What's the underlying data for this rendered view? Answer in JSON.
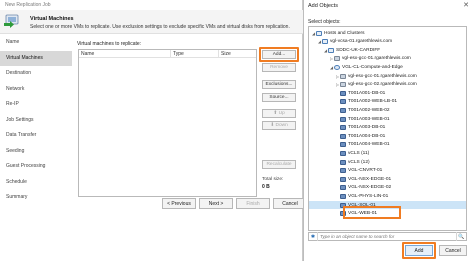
{
  "job_window": {
    "title": "New Replication Job",
    "header_title": "Virtual Machines",
    "header_desc": "Select one or more VMs to replicate. Use exclusion settings to exclude specific VMs and virtual disks from replication.",
    "nav": [
      {
        "label": "Name"
      },
      {
        "label": "Virtual Machines"
      },
      {
        "label": "Destination"
      },
      {
        "label": "Network"
      },
      {
        "label": "Re-IP"
      },
      {
        "label": "Job Settings"
      },
      {
        "label": "Data Transfer"
      },
      {
        "label": "Seeding"
      },
      {
        "label": "Guest Processing"
      },
      {
        "label": "Schedule"
      },
      {
        "label": "Summary"
      }
    ],
    "vm_list_label": "Virtual machines to replicate:",
    "columns": [
      "Name",
      "Type",
      "Size"
    ],
    "buttons": {
      "add": "Add...",
      "remove": "Remove",
      "exclusions": "Exclusions...",
      "source": "Source...",
      "up": "Up",
      "down": "Down",
      "recalculate": "Recalculate"
    },
    "total_size_label": "Total size:",
    "total_size_value": "0 B",
    "footer": {
      "previous": "< Previous",
      "next": "Next >",
      "finish": "Finish",
      "cancel": "Cancel"
    }
  },
  "add_objects": {
    "title": "Add Objects",
    "close": "✕",
    "select_label": "Select objects:",
    "tree": [
      {
        "label": "Hosts and Clusters",
        "depth": 0,
        "caret": "◢",
        "icon": "folder"
      },
      {
        "label": "vgl-vcsa-01.rgarethlewis.com",
        "depth": 1,
        "caret": "◢",
        "icon": "vcenter"
      },
      {
        "label": "SDDC-UK-CARDIFF",
        "depth": 2,
        "caret": "◢",
        "icon": "datacenter"
      },
      {
        "label": "vgl-esx-gcc-01.rgarethlewis.com",
        "depth": 3,
        "caret": "▷",
        "icon": "host"
      },
      {
        "label": "VGL-CL-Compute-and-Edge",
        "depth": 3,
        "caret": "◢",
        "icon": "cluster"
      },
      {
        "label": "vgl-esx-gcc-01.rgarethlewis.com",
        "depth": 4,
        "caret": "▷",
        "icon": "host"
      },
      {
        "label": "vgl-esx-gcc-02.rgarethlewis.com",
        "depth": 4,
        "caret": "▷",
        "icon": "host"
      },
      {
        "label": "T001A001-DB-01",
        "depth": 4,
        "caret": "",
        "icon": "vm"
      },
      {
        "label": "T001A002-WEB-LB-01",
        "depth": 4,
        "caret": "",
        "icon": "vm"
      },
      {
        "label": "T001A002-WEB-02",
        "depth": 4,
        "caret": "",
        "icon": "vm"
      },
      {
        "label": "T001A003-WEB-01",
        "depth": 4,
        "caret": "",
        "icon": "vm"
      },
      {
        "label": "T001A003-DB-01",
        "depth": 4,
        "caret": "",
        "icon": "vm"
      },
      {
        "label": "T001A004-DB-01",
        "depth": 4,
        "caret": "",
        "icon": "vm"
      },
      {
        "label": "T001A004-WEB-01",
        "depth": 4,
        "caret": "",
        "icon": "vm"
      },
      {
        "label": "vCLS (11)",
        "depth": 4,
        "caret": "",
        "icon": "vm"
      },
      {
        "label": "vCLS (12)",
        "depth": 4,
        "caret": "",
        "icon": "vm"
      },
      {
        "label": "VGL-CNVRT-01",
        "depth": 4,
        "caret": "",
        "icon": "vm"
      },
      {
        "label": "VGL-NSX-EDGE-01",
        "depth": 4,
        "caret": "",
        "icon": "vm"
      },
      {
        "label": "VGL-NSX-EDGE-02",
        "depth": 4,
        "caret": "",
        "icon": "vm"
      },
      {
        "label": "VGL-PHYS-LIN-01",
        "depth": 4,
        "caret": "",
        "icon": "vm"
      },
      {
        "label": "VGL-SQL-01",
        "depth": 4,
        "caret": "",
        "icon": "vm",
        "selected": true
      },
      {
        "label": "VGL-WEB-01",
        "depth": 4,
        "caret": "",
        "icon": "vm"
      }
    ],
    "search_placeholder": "Type in an object name to search for",
    "search_go": "🔍",
    "add": "Add",
    "cancel": "Cancel"
  },
  "colors": {
    "highlight": "#f07c22",
    "selection": "#cce4f7"
  }
}
